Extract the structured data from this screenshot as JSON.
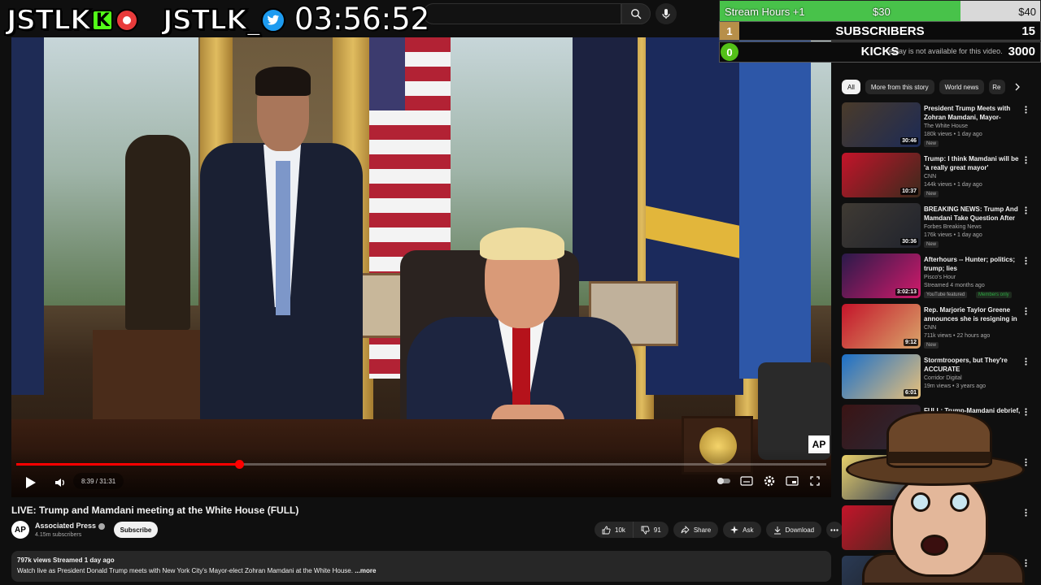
{
  "overlay": {
    "logo_left": "JSTLK",
    "logo_left_badge": "K",
    "logo_right": "JSTLK_",
    "clock": "03:56:52"
  },
  "stats": {
    "goal_label": "Stream Hours +1",
    "goal_current": "$30",
    "goal_max": "$40",
    "goal_progress": 0.75,
    "subs_index": "1",
    "subs_label": "SUBSCRIBERS",
    "subs_value": "15",
    "kicks_index": "0",
    "kicks_label": "KICKS",
    "kicks_value": "3000",
    "replay_note": "replay is not available for this video."
  },
  "player": {
    "time": "8:39 / 31:31",
    "progress": 0.275,
    "watermark": "AP"
  },
  "video": {
    "title": "LIVE: Trump and Mamdani meeting at the White House (FULL)",
    "channel_avatar": "AP",
    "channel": "Associated Press",
    "subscribers": "4.15m subscribers",
    "subscribe_label": "Subscribe",
    "likes": "10k",
    "dislikes": "91",
    "share_label": "Share",
    "ask_label": "Ask",
    "download_label": "Download",
    "desc_meta": "797k views  Streamed 1 day ago",
    "desc_text": "Watch live as President Donald Trump meets with New York City's Mayor-elect Zohran Mamdani at the White House. ",
    "desc_more": "...more"
  },
  "chips": [
    "All",
    "More from this story",
    "World news",
    "Re"
  ],
  "recommendations": [
    {
      "title": "President Trump Meets with Zohran Mamdani, Mayor-Elect,...",
      "channel": "The White House",
      "stats": "180k views • 1 day ago",
      "badge": "New",
      "duration": "30:46",
      "thumb": [
        "#4a3b2a",
        "#1c2a55"
      ]
    },
    {
      "title": "Trump: I think Mamdani will be 'a really great mayor'",
      "channel": "CNN",
      "stats": "144k views • 1 day ago",
      "badge": "New",
      "duration": "10:37",
      "thumb": [
        "#c4142a",
        "#3a2a1c"
      ]
    },
    {
      "title": "BREAKING NEWS: Trump And Mamdani Take Question After ...",
      "channel": "Forbes Breaking News",
      "stats": "176k views • 1 day ago",
      "badge": "New",
      "duration": "30:36",
      "thumb": [
        "#3f3a33",
        "#20232d"
      ]
    },
    {
      "title": "Afterhours -- Hunter; politics; trump; lies",
      "channel": "Pisco's Hour",
      "stats": "Streamed 4 months ago",
      "badge": "YouTube featured",
      "badge2": "Members only",
      "duration": "3:02:13",
      "thumb": [
        "#2a1a4a",
        "#d11a6a"
      ]
    },
    {
      "title": "Rep. Marjorie Taylor Greene announces she is resigning in ...",
      "channel": "CNN",
      "stats": "711k views • 22 hours ago",
      "badge": "New",
      "duration": "9:12",
      "thumb": [
        "#c4142a",
        "#d9a56a"
      ]
    },
    {
      "title": "Stormtroopers, but They're ACCURATE",
      "channel": "Corridor Digital",
      "stats": "19m views • 3 years ago",
      "badge": "",
      "duration": "6:01",
      "thumb": [
        "#1a6fc9",
        "#e8c07a"
      ]
    },
    {
      "title": "FULL: Trump-Mamdani debrief, Q&A",
      "channel": "",
      "stats": "",
      "badge": "",
      "duration": "",
      "thumb": [
        "#3a1414",
        "#2a2a3a"
      ]
    },
    {
      "title": "",
      "channel": "",
      "stats": "",
      "badge": "",
      "duration": "",
      "thumb": [
        "#e8d06a",
        "#1b2a55"
      ]
    },
    {
      "title": "",
      "channel": "",
      "stats": "",
      "badge": "",
      "duration": "",
      "thumb": [
        "#c4142a",
        "#3a2a1c"
      ]
    },
    {
      "title": "",
      "channel": "",
      "stats": "",
      "badge": "",
      "duration": "",
      "thumb": [
        "#2a3a55",
        "#1a1a1a"
      ]
    }
  ],
  "colors": {
    "youtube_red": "#ff0000",
    "goal_fill": "#48c24a",
    "kick_green": "#53fc18"
  }
}
